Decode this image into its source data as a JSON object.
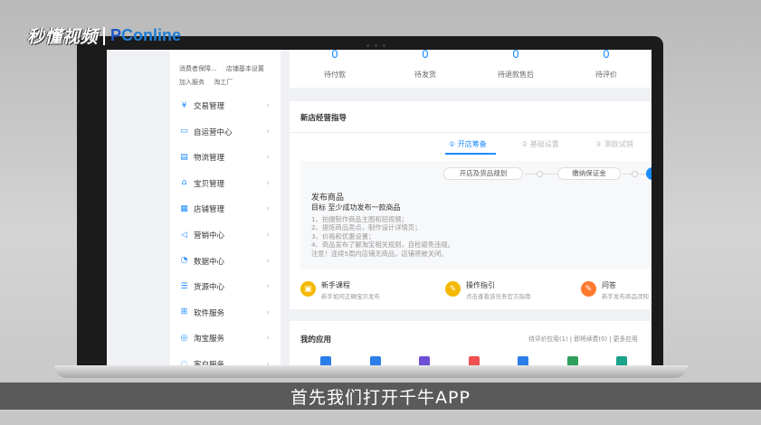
{
  "watermark": {
    "channel": "秒懂视频",
    "brand_p": "P",
    "brand_rest": "Conline"
  },
  "sidebar": {
    "small_links": [
      [
        "消费者保障...",
        "店铺基本设置"
      ],
      [
        "加入服务",
        "淘工厂"
      ]
    ],
    "items": [
      {
        "label": "交易管理",
        "icon": "transaction-icon",
        "glyph": "¥"
      },
      {
        "label": "自运营中心",
        "icon": "chat-icon",
        "glyph": "▭"
      },
      {
        "label": "物流管理",
        "icon": "truck-icon",
        "glyph": "▤"
      },
      {
        "label": "宝贝管理",
        "icon": "bag-icon",
        "glyph": "⌂"
      },
      {
        "label": "店铺管理",
        "icon": "store-icon",
        "glyph": "▦"
      },
      {
        "label": "营销中心",
        "icon": "megaphone-icon",
        "glyph": "◁"
      },
      {
        "label": "数据中心",
        "icon": "chart-icon",
        "glyph": "◔"
      },
      {
        "label": "货源中心",
        "icon": "list-icon",
        "glyph": "☰"
      },
      {
        "label": "软件服务",
        "icon": "grid-icon",
        "glyph": "⊞"
      },
      {
        "label": "淘宝服务",
        "icon": "service-icon",
        "glyph": "◎"
      },
      {
        "label": "客户服务",
        "icon": "headset-icon",
        "glyph": "◌"
      }
    ],
    "arrow": "›"
  },
  "stats": [
    {
      "value": "0",
      "label": "待付款"
    },
    {
      "value": "0",
      "label": "待发货"
    },
    {
      "value": "0",
      "label": "待退款售后"
    },
    {
      "value": "0",
      "label": "待评价"
    }
  ],
  "guide": {
    "title": "新店经营指导",
    "tabs": [
      "① 开店筹备",
      "② 基础设置",
      "③ 测款试销"
    ],
    "pills": [
      "开店及货品规划",
      "缴纳保证金"
    ],
    "publish_title": "发布商品",
    "publish_target": "目标 至少成功发布一款商品",
    "publish_lines": [
      "1、拍摄制作商品主图和短视频；",
      "2、提炼商品卖点，制作设计详情页；",
      "3、价格和优惠设置；",
      "4、商品发布了解淘宝相关规则，自检避免违规。",
      "注意！连续5周内店铺无商品，店铺将被关闭。"
    ]
  },
  "actions": [
    {
      "title": "新手课程",
      "sub": "新手如何正确宝贝发布",
      "icon": "course-icon",
      "glyph": "▣",
      "color": "#f5b800"
    },
    {
      "title": "操作指引",
      "sub": "点击查看该任务官方指南",
      "icon": "guide-icon",
      "glyph": "✎",
      "color": "#f5b800"
    },
    {
      "title": "问答",
      "sub": "新手发布商品须知",
      "icon": "qa-icon",
      "glyph": "✎",
      "color": "#ff7a2e"
    }
  ],
  "apps": {
    "title": "我的应用",
    "links": "待评价应用(1) | 即将续费(0) | 更多应用",
    "icon_colors": [
      "#2b7de9",
      "#2b7de9",
      "#6d4fd6",
      "#ef4f4f",
      "#2b7de9",
      "#2fa05c",
      "#1aa38a"
    ]
  },
  "caption": "首先我们打开千牛APP"
}
